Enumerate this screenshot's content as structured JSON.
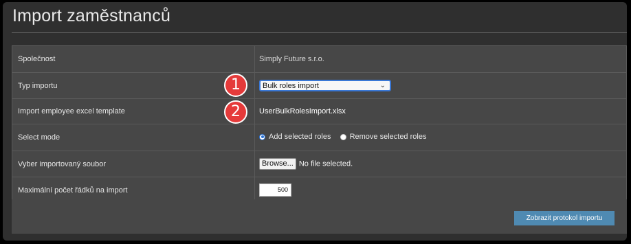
{
  "page": {
    "title": "Import zaměstnanců"
  },
  "form": {
    "company_label": "Společnost",
    "company_value": "Simply Future s.r.o.",
    "import_type_label": "Typ importu",
    "import_type_value": "Bulk roles import",
    "template_label": "Import employee excel template",
    "template_value": "UserBulkRolesImport.xlsx",
    "select_mode_label": "Select mode",
    "mode_add": "Add selected roles",
    "mode_remove": "Remove selected roles",
    "mode_selected": "Add selected roles",
    "file_label": "Vyber importovaný soubor",
    "browse_label": "Browse...",
    "file_status": "No file selected.",
    "max_rows_label": "Maximální počet řádků na import",
    "max_rows_value": "500"
  },
  "actions": {
    "protocol_button": "Zobrazit protokol importu"
  },
  "annotations": {
    "badge1": "1",
    "badge2": "2"
  },
  "colors": {
    "panel": "#2f2f2f",
    "table": "#474747",
    "badge": "#e53a3a",
    "button": "#4f8ab2",
    "focus": "#3a78d6"
  },
  "icons": [
    "chevron-down-icon",
    "radio-icon"
  ]
}
